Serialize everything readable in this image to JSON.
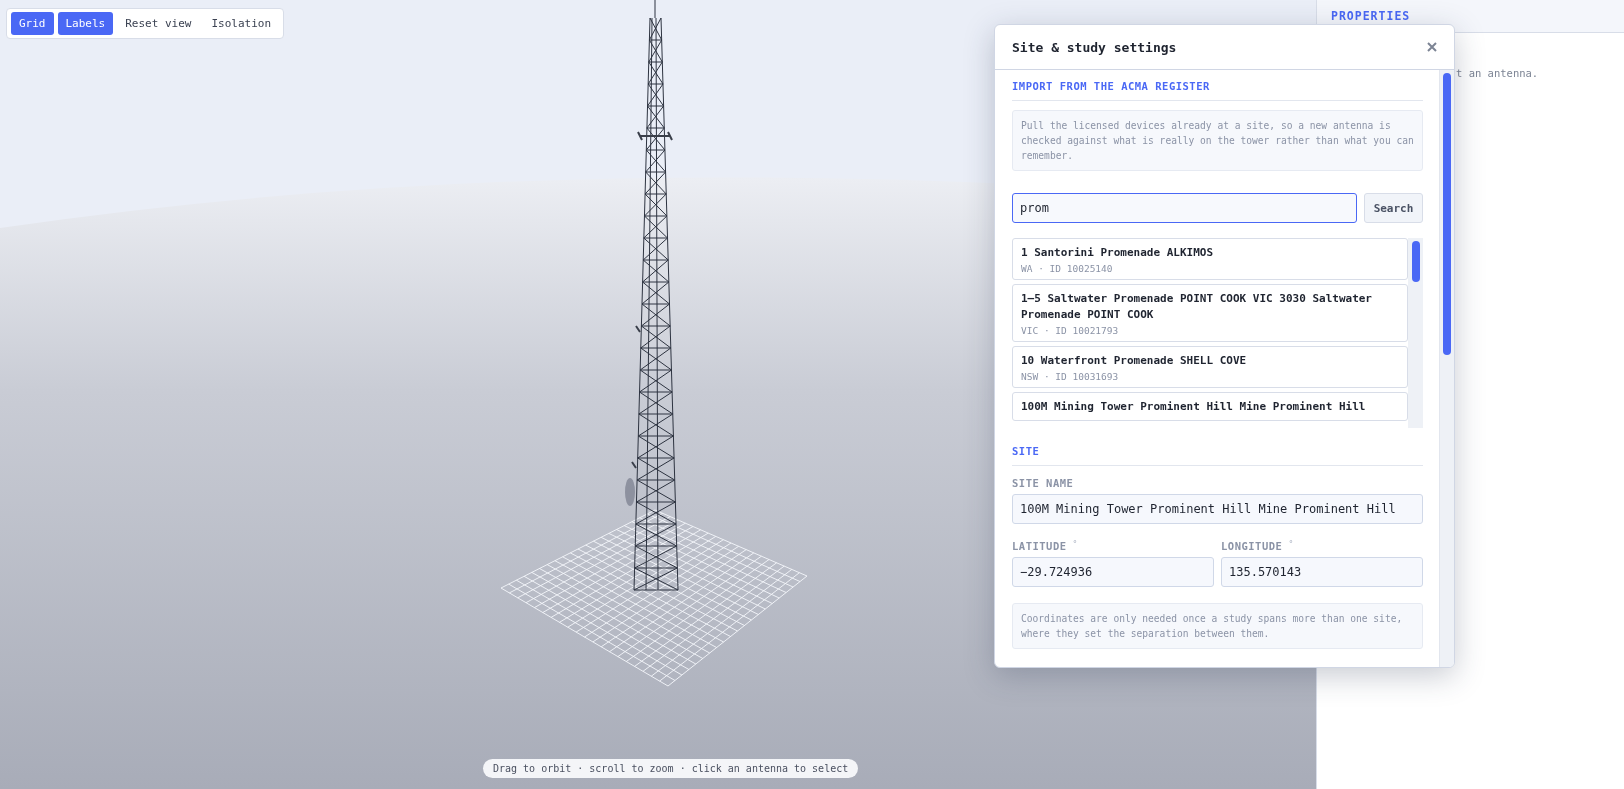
{
  "toolbar": [
    {
      "label": "Grid",
      "on": true
    },
    {
      "label": "Labels",
      "on": true
    },
    {
      "label": "Reset view",
      "on": false
    },
    {
      "label": "Isolation",
      "on": false
    }
  ],
  "hint": "Drag to orbit · scroll to zoom · click an antenna to select",
  "properties_panel": {
    "title": "PROPERTIES",
    "message": "t an antenna."
  },
  "dialog": {
    "title": "Site & study settings",
    "import_section": {
      "heading": "IMPORT FROM THE ACMA REGISTER",
      "note": "Pull the licensed devices already at a site, so a new antenna is checked against what is really on the tower rather than what you can remember.",
      "search": {
        "value": "prom"
      },
      "search_button": "Search",
      "results": [
        {
          "name": "1 Santorini Promenade ALKIMOS",
          "meta": "WA · ID 10025140"
        },
        {
          "name": "1–5 Saltwater Promenade POINT COOK VIC 3030 Saltwater Promenade POINT COOK",
          "meta": "VIC · ID 10021793"
        },
        {
          "name": "10 Waterfront Promenade SHELL COVE",
          "meta": "NSW · ID 10031693"
        },
        {
          "name": "100M Mining Tower Prominent Hill Mine Prominent Hill"
        }
      ]
    },
    "site_section": {
      "heading": "SITE",
      "site_name": {
        "label": "SITE NAME",
        "value": "100M Mining Tower Prominent Hill Mine Prominent Hill"
      },
      "latitude": {
        "label": "LATITUDE",
        "unit": "°",
        "value": "−29.724936"
      },
      "longitude": {
        "label": "LONGITUDE",
        "unit": "°",
        "value": "135.570143"
      },
      "note": "Coordinates are only needed once a study spans more than one site, where they set the separation between them."
    }
  }
}
